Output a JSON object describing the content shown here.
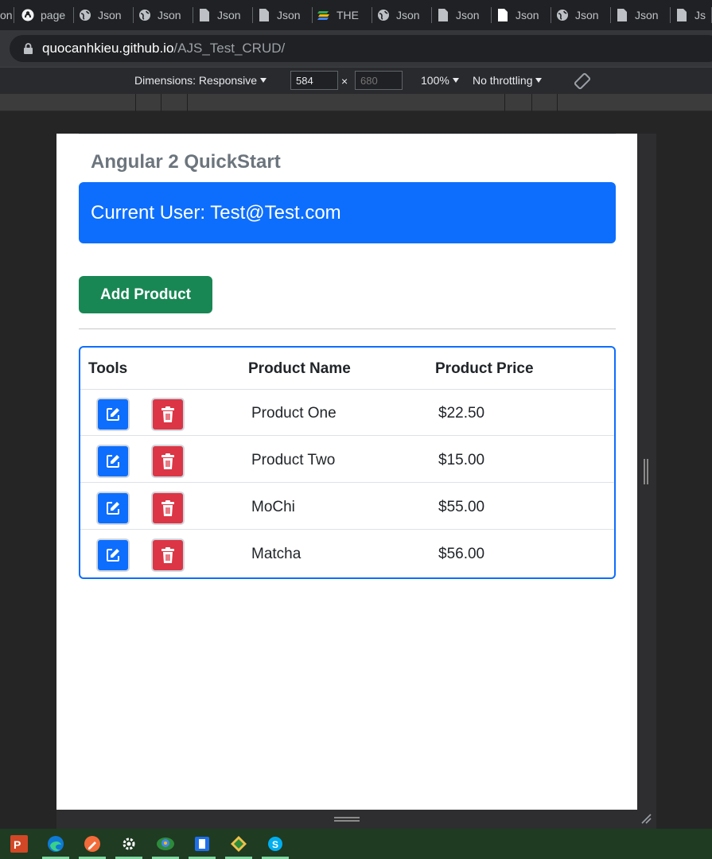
{
  "browser": {
    "tabs": [
      {
        "label": "on",
        "icon": "globe-icon"
      },
      {
        "label": "page",
        "icon": "github-icon"
      },
      {
        "label": "Json",
        "icon": "globe-icon"
      },
      {
        "label": "Json",
        "icon": "globe-icon"
      },
      {
        "label": "Json",
        "icon": "document-icon"
      },
      {
        "label": "Json",
        "icon": "document-icon"
      },
      {
        "label": "THE",
        "icon": "layers-icon"
      },
      {
        "label": "Json",
        "icon": "globe-icon"
      },
      {
        "label": "Json",
        "icon": "document-icon"
      },
      {
        "label": "Json",
        "icon": "document-icon"
      },
      {
        "label": "Json",
        "icon": "globe-icon"
      },
      {
        "label": "Json",
        "icon": "document-icon"
      },
      {
        "label": "Js",
        "icon": "document-icon"
      }
    ],
    "url_host": "quocanhkieu.github.io",
    "url_path": "/AJS_Test_CRUD/"
  },
  "devtools": {
    "dimensions_label": "Dimensions: Responsive",
    "width": "584",
    "height_placeholder": "680",
    "times": "×",
    "zoom": "100%",
    "throttling": "No throttling"
  },
  "page": {
    "title": "Angular 2 QuickStart",
    "current_user": "Current User: Test@Test.com",
    "add_button": "Add Product",
    "table": {
      "headers": {
        "tools": "Tools",
        "name": "Product Name",
        "price": "Product Price"
      },
      "rows": [
        {
          "name": "Product One",
          "price": "$22.50"
        },
        {
          "name": "Product Two",
          "price": "$15.00"
        },
        {
          "name": "MoChi",
          "price": "$55.00"
        },
        {
          "name": "Matcha",
          "price": "$56.00"
        }
      ]
    }
  },
  "colors": {
    "primary": "#0d6efd",
    "success": "#198754",
    "danger": "#dc3545"
  },
  "taskbar": {
    "apps": [
      "powerpoint-icon",
      "edge-icon",
      "pen-app-icon",
      "settings-icon",
      "photos-icon",
      "app-icon",
      "git-icon",
      "skype-icon"
    ]
  }
}
